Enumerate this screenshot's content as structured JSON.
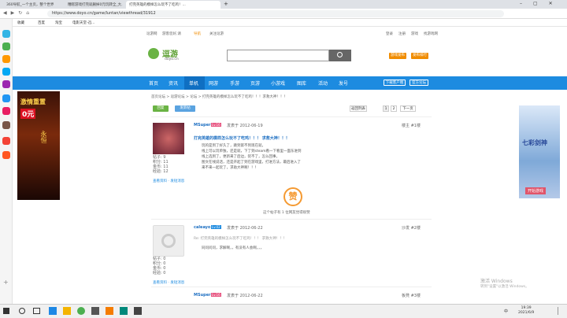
{
  "browser": {
    "tabs": [
      "360导航_一个主页，整个世界",
      "糟糕游戏打完就删掉0元玩转全_大...",
      "打完英雄的模样怎么玩不了吃鸡！..."
    ],
    "url": "https://www.doyo.cn/game/luntan/viewthread/31912",
    "bookmarks": [
      "收藏",
      "百度",
      "淘宝",
      "电影天堂-迅..."
    ]
  },
  "site": {
    "top_links": [
      "逗游网",
      "游客您好,请",
      "导航",
      "关注逗游"
    ],
    "top_right": [
      "登录",
      "注册",
      "游戏",
      "找游戏网"
    ],
    "logo_text": "逗游",
    "logo_sub": "doyo.cn",
    "search_placeholder": "",
    "btn_upload": "游戏发布",
    "btn_hot": "发布排行",
    "nav": [
      "首页",
      "资讯",
      "单机",
      "网游",
      "手游",
      "页游",
      "小游戏",
      "图库",
      "活动",
      "发号"
    ],
    "nav_right": [
      "下载客户端",
      "官方论坛"
    ],
    "breadcrumb": "首页论坛 > 逗游论坛 > 论坛 > 打完英雄的模样怎么玩不了吃鸡！！！求救大神！！！",
    "reply_btn": "回复",
    "new_btn": "发新帖",
    "back_list": "返回列表",
    "pages": [
      "1",
      "2"
    ],
    "next_page": "下一页",
    "like_label": "赞",
    "like_note": "这个帖子有 1 位网友觉得很赞",
    "watermark1": "激活 Windows",
    "watermark2": "转到\"设置\"以激活 Windows。"
  },
  "posts": [
    {
      "user": "MSuper",
      "level": "Lv.16",
      "date": "发表于 2012-06-19",
      "floor": "楼主 #1楼",
      "title": "打完英雄的模样怎么玩不了吃鸡！！！ 求救大神！！！",
      "lines": [
        "玩的是到了好久了，跳到第不到现在就，",
        "线上可以玩单独，还是就，下了到steam看一下看里一面东进到",
        "线上选到了，更新来了后边，装不了，怎么回事，",
        "图文在线说话，还是开起了到在游戏里，打进方法，最后进入了",
        "来不来一起玩了，求助大神啊！！！"
      ],
      "stats": [
        [
          "帖子",
          "9"
        ],
        [
          "积分",
          "11"
        ],
        [
          "金币",
          "11"
        ],
        [
          "经验",
          "12"
        ]
      ],
      "links": [
        "查看资料",
        "发短消息"
      ]
    },
    {
      "user": "caleayo",
      "level": "Lv.02",
      "date": "发表于 2012-06-22",
      "floor": "沙发 #2楼",
      "quote": "Re: 打完英雄的模样怎么玩不了吃鸡！！！ 求救大神！！！",
      "lines": [
        "同问问问，求解啊，，有没有人会啊，，，"
      ],
      "stats": [
        [
          "帖子",
          "0"
        ],
        [
          "积分",
          "0"
        ],
        [
          "金币",
          "0"
        ],
        [
          "经验",
          "0"
        ]
      ],
      "links": [
        "查看资料",
        "发短消息"
      ]
    },
    {
      "user": "MSuper",
      "level": "Lv.16",
      "date": "发表于 2012-06-22",
      "floor": "板凳 #3楼"
    }
  ],
  "ads": {
    "left_title": "激情重置",
    "left_sub": "0元",
    "left_line": "永恒",
    "right_title": "七彩剑神",
    "right_sub": "开始游戏"
  },
  "taskbar": {
    "time": "19:39",
    "date": "2021/6/9",
    "lang": "中"
  },
  "colors": {
    "nav": "#1d8be0",
    "accent": "#f08c00",
    "green": "#6ab344",
    "like": "#f59a32"
  }
}
